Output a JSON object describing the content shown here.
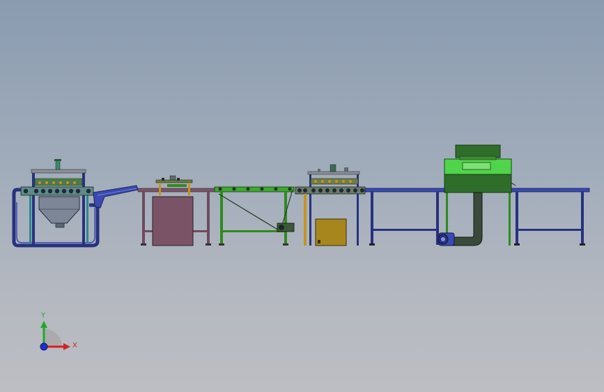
{
  "triad": {
    "x_label": "X",
    "y_label": "Y",
    "x_color": "#d42020",
    "y_color": "#1fa82a",
    "z_color": "#2030d0"
  },
  "colors": {
    "blue_frame": "#27327e",
    "blue_frame_light": "#3b4ab0",
    "mauve_frame": "#6f4a5e",
    "mauve_panel": "#7a5466",
    "green_frame": "#2f8a1f",
    "green_bright": "#4fd44a",
    "green_dark": "#2f6d2a",
    "yellow_frame": "#c8941a",
    "olive_box": "#a8861e",
    "gray_roller": "#5f6a6a",
    "teal_post": "#2a8b8b"
  },
  "machines": [
    "sandblaster-hopper-station",
    "rotary-conveyor-hood",
    "inclined-belt-conveyor",
    "roller-brush-station",
    "drying-cabinet-conveyor"
  ]
}
